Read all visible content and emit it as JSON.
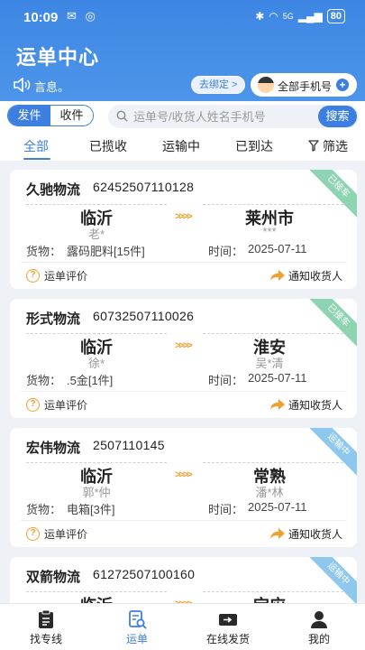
{
  "status_bar": {
    "time": "10:09",
    "battery": "80",
    "network": "5G"
  },
  "header": {
    "title": "运单中心"
  },
  "notice": {
    "text": "言息。",
    "bind_button": "去绑定 >",
    "phone_selector": "全部手机号",
    "plus": "+"
  },
  "search": {
    "seg_send": "发件",
    "seg_receive": "收件",
    "placeholder": "运单号/收货人姓名手机号",
    "button": "搜索"
  },
  "tabs": [
    {
      "label": "全部",
      "active": true
    },
    {
      "label": "已揽收",
      "active": false
    },
    {
      "label": "运输中",
      "active": false
    },
    {
      "label": "已到达",
      "active": false
    },
    {
      "label": "筛选",
      "active": false
    }
  ],
  "labels": {
    "goods": "货物：",
    "time": "时间：",
    "evaluate": "运单评价",
    "notify": "通知收货人"
  },
  "colors": {
    "primary": "#3d7fe0",
    "ribbon_picked": "#8fd4b2",
    "ribbon_transit": "#8fc8ee",
    "accent": "#f0a030"
  },
  "orders": [
    {
      "carrier": "久驰物流",
      "waybill": "62452507110128",
      "status": "已接车",
      "status_color": "#8fd4b2",
      "from_city": "临沂",
      "from_person": "老*",
      "to_city": "莱州市",
      "to_person": "***",
      "goods": "露码肥料[15件]",
      "time": "2025-07-11"
    },
    {
      "carrier": "形式物流",
      "waybill": "60732507110026",
      "status": "已接车",
      "status_color": "#8fd4b2",
      "from_city": "临沂",
      "from_person": "徐*",
      "to_city": "淮安",
      "to_person": "吴*清",
      "goods": ".5金[1件]",
      "time": "2025-07-11"
    },
    {
      "carrier": "宏伟物流",
      "waybill": "2507110145",
      "status": "运输中",
      "status_color": "#8fc8ee",
      "from_city": "临沂",
      "from_person": "郭*仲",
      "to_city": "常熟",
      "to_person": "潘*林",
      "goods": "电箱[3件]",
      "time": "2025-07-11"
    },
    {
      "carrier": "双箭物流",
      "waybill": "61272507100160",
      "status": "运输中",
      "status_color": "#8fc8ee",
      "from_city": "临沂",
      "from_person": "",
      "to_city": "宝应",
      "to_person": "",
      "goods": "",
      "time": ""
    }
  ],
  "nav": [
    {
      "label": "找专线",
      "icon": "clipboard-icon",
      "active": false
    },
    {
      "label": "运单",
      "icon": "waybill-search-icon",
      "active": true
    },
    {
      "label": "在线发货",
      "icon": "ship-card-icon",
      "active": false
    },
    {
      "label": "我的",
      "icon": "person-icon",
      "active": false
    }
  ]
}
